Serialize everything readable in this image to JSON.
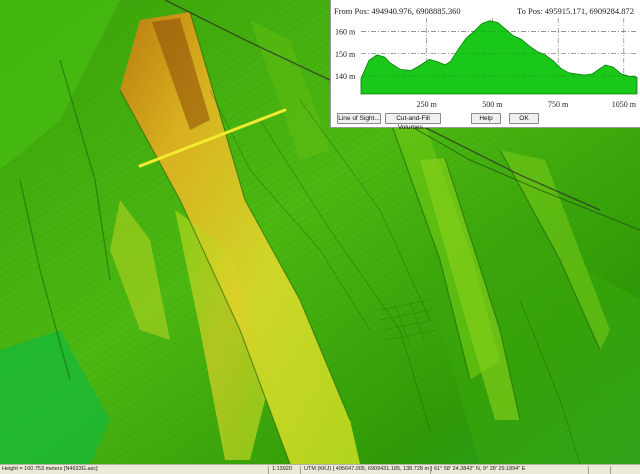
{
  "profile": {
    "from_pos": "From Pos: 494940.976, 6908885.360",
    "to_pos": "To Pos: 495915.171, 6909284.872",
    "y_ticks": [
      {
        "value": 140,
        "label": "140 m"
      },
      {
        "value": 150,
        "label": "150 m"
      },
      {
        "value": 160,
        "label": "160 m"
      }
    ],
    "x_ticks": [
      {
        "value": 250,
        "label": "250 m"
      },
      {
        "value": 500,
        "label": "500 m"
      },
      {
        "value": 750,
        "label": "750 m"
      },
      {
        "value": 1000,
        "label": "1050 m"
      }
    ],
    "xlim": [
      0,
      1050
    ],
    "ylim": [
      132,
      166
    ],
    "colors": {
      "fill": "#19c819",
      "line": "#0a7d0a",
      "grid": "#555555"
    }
  },
  "chart_data": {
    "type": "area",
    "title": "",
    "xlabel": "",
    "ylabel": "",
    "xlim": [
      0,
      1050
    ],
    "ylim": [
      132,
      166
    ],
    "grid": true,
    "x": [
      0,
      30,
      60,
      90,
      110,
      150,
      190,
      220,
      260,
      290,
      320,
      340,
      370,
      400,
      430,
      460,
      490,
      520,
      550,
      580,
      610,
      640,
      670,
      700,
      730,
      760,
      790,
      820,
      850,
      880,
      910,
      930,
      960,
      990,
      1020,
      1050
    ],
    "series": [
      {
        "values": [
          139,
          147,
          149.5,
          148.5,
          146,
          143,
          142.5,
          144.5,
          147.5,
          146.5,
          145,
          146.5,
          152,
          157,
          160,
          163.5,
          164.8,
          164,
          161,
          158,
          156.5,
          153.5,
          151,
          149.5,
          147,
          143.5,
          141.5,
          141,
          140.5,
          141,
          143.5,
          145,
          144,
          141,
          140,
          139.5
        ]
      }
    ]
  },
  "buttons": {
    "line_of_sight": "Line of Sight...",
    "cut_fill": "Cut-and-Fill Volumes...",
    "help": "Help",
    "ok": "OK"
  },
  "status": {
    "height": "Height = 160.753 meters [N4633G.asc]",
    "scale": "1:13920",
    "utm": "UTM (KKJ) [ 495647.005, 6909431.185, 138.728 m ]",
    "latlon": "61° 58' 24.3842\" N, 9° 28' 29.1894\" E"
  }
}
